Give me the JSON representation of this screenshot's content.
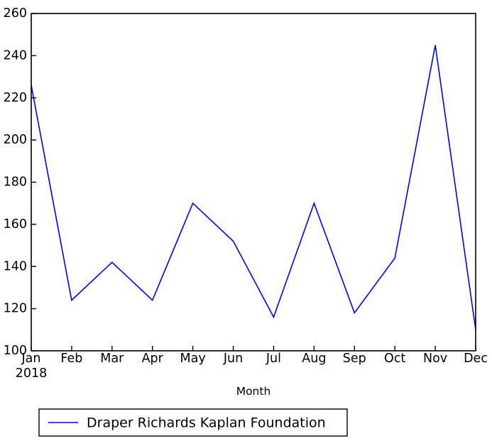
{
  "chart_data": {
    "type": "line",
    "title": "",
    "xlabel": "Month",
    "ylabel": "",
    "categories": [
      "Jan",
      "Feb",
      "Mar",
      "Apr",
      "May",
      "Jun",
      "Jul",
      "Aug",
      "Sep",
      "Oct",
      "Nov",
      "Dec"
    ],
    "x_subtick_label": "2018",
    "series": [
      {
        "name": "Draper Richards Kaplan Foundation",
        "color": "#0000ff",
        "values": [
          226,
          124,
          142,
          124,
          170,
          152,
          116,
          170,
          118,
          144,
          245,
          110
        ]
      }
    ],
    "ylim": [
      100,
      260
    ],
    "yticks": [
      100,
      120,
      140,
      160,
      180,
      200,
      220,
      240,
      260
    ],
    "ytick_labels": [
      "100",
      "120",
      "140",
      "160",
      "180",
      "200",
      "220",
      "240",
      "260"
    ],
    "grid": false,
    "legend_position": "below-axes-center",
    "frame_color": "#000000"
  },
  "legend": {
    "entries": [
      {
        "label": "Draper Richards Kaplan Foundation",
        "color": "#0000ff"
      }
    ]
  },
  "axis": {
    "x_title": "Month",
    "y_title": ""
  }
}
